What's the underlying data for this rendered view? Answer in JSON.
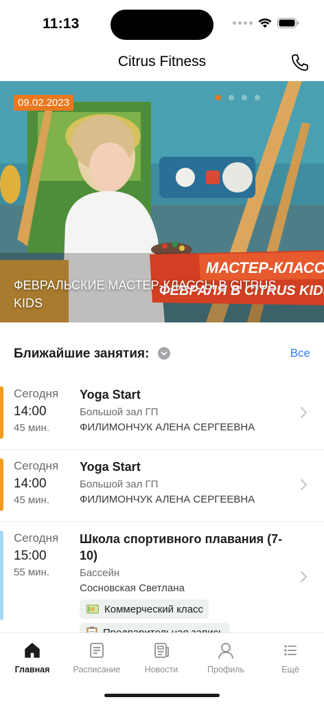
{
  "status": {
    "time": "11:13"
  },
  "header": {
    "title": "Citrus Fitness"
  },
  "hero": {
    "date": "09.02.2023",
    "title": "ФЕВРАЛЬСКИЕ МАСТЕР-КЛАССЫ В CITRUS KIDS",
    "banner_line1": "МАСТЕР-КЛАССЫ",
    "banner_line2": "ФЕВРАЛЯ В CITRUS KIDS",
    "slide_count": 4,
    "active_slide": 1
  },
  "section": {
    "title": "Ближайшие занятия:",
    "see_all": "Все"
  },
  "classes": [
    {
      "day": "Сегодня",
      "time": "14:00",
      "duration": "45 мин.",
      "name": "Yoga Start",
      "room": "Большой зал ГП",
      "trainer": "ФИЛИМОНЧУК АЛЕНА СЕРГЕЕВНА",
      "accent_color": "#f39a1e"
    },
    {
      "day": "Сегодня",
      "time": "14:00",
      "duration": "45 мин.",
      "name": "Yoga Start",
      "room": "Большой зал ГП",
      "trainer": "ФИЛИМОНЧУК АЛЕНА СЕРГЕЕВНА",
      "accent_color": "#f39a1e"
    },
    {
      "day": "Сегодня",
      "time": "15:00",
      "duration": "55 мин.",
      "name": "Школа спортивного плавания (7-10)",
      "room": "Бассейн",
      "trainer": "Сосновская Светлана",
      "accent_color": "#a9d6f5",
      "tags": [
        {
          "label": "Коммерческий класс",
          "icon": "money-icon"
        },
        {
          "label": "Предварительная запись",
          "icon": "clipboard-icon"
        }
      ]
    }
  ],
  "tabbar": {
    "items": [
      {
        "label": "Главная",
        "icon": "home-icon",
        "active": true
      },
      {
        "label": "Расписание",
        "icon": "schedule-icon",
        "active": false
      },
      {
        "label": "Новости",
        "icon": "news-icon",
        "active": false
      },
      {
        "label": "Профиль",
        "icon": "profile-icon",
        "active": false
      },
      {
        "label": "Ещё",
        "icon": "more-icon",
        "active": false
      }
    ]
  },
  "colors": {
    "accent_orange": "#e9781e",
    "link_blue": "#2d7ff0",
    "swim_blue": "#a9d6f5"
  }
}
